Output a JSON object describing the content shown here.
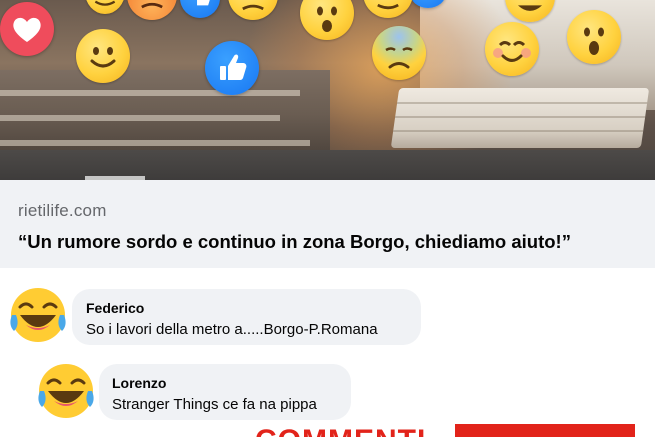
{
  "post": {
    "image": {
      "description_icons": [
        "heart-reaction",
        "like-reaction",
        "smile-emoji",
        "wow-emoji",
        "sad-emoji",
        "angry-emoji",
        "laugh-emoji"
      ]
    },
    "link": {
      "domain": "rietilife.com",
      "headline": "“Un rumore sordo e continuo in zona Borgo, chiediamo aiuto!”"
    }
  },
  "comments": [
    {
      "author": "Federico",
      "text": "So i lavori della metro a.....Borgo-P.Romana",
      "reaction_icon": "laugh-emoji"
    },
    {
      "author": "Lorenzo",
      "text": "Stranger Things ce fa na pippa",
      "reaction_icon": "laugh-emoji"
    }
  ],
  "overlay": {
    "banner_text": "COMMENTI",
    "accent_color": "#e2231a"
  },
  "colors": {
    "heart": "#ef4c5c",
    "like": "#1877f2",
    "bubble_bg": "#f0f2f5",
    "domain_text": "#65676b"
  }
}
